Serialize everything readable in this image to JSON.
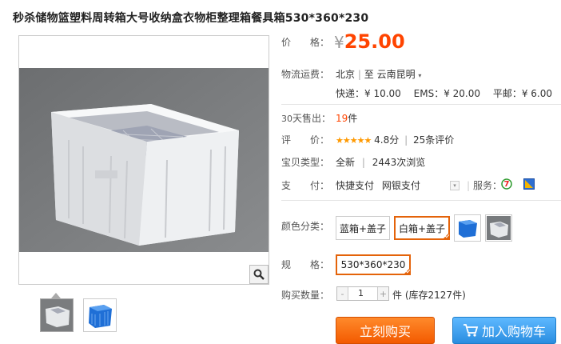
{
  "title": "秒杀储物篮塑料周转箱大号收纳盒衣物柜整理箱餐具箱530*360*230",
  "price": {
    "label": "价　　格：",
    "symbol": "¥",
    "value": "25.00"
  },
  "shipping": {
    "label": "物流运费：",
    "from": "北京",
    "sep": "|",
    "to_label": "至",
    "dest": "云南昆明",
    "express": "快递：¥ 10.00",
    "ems": "EMS：¥ 20.00",
    "surface": "平邮：¥ 6.00"
  },
  "sales": {
    "label_days": "30",
    "label": "天售出：",
    "count": "19",
    "unit": "件"
  },
  "rating": {
    "label": "评　　价：",
    "stars": "★★★★★",
    "score": "4.8分",
    "sep": "|",
    "reviews_count": "25",
    "reviews_suffix": "条评价"
  },
  "type": {
    "label": "宝贝类型：",
    "value": "全新",
    "sep": "|",
    "views_count": "2443",
    "views_suffix": "次浏览"
  },
  "payment": {
    "label": "支　　付：",
    "method1": "快捷支付",
    "method2": "网银支付",
    "service_label": "服务："
  },
  "color": {
    "label": "颜色分类：",
    "options": [
      "蓝箱+盖子",
      "白箱+盖子"
    ],
    "selected": "白箱+盖子"
  },
  "spec": {
    "label": "规　　格：",
    "value": "530*360*230"
  },
  "quantity": {
    "label": "购买数量：",
    "value": "1",
    "minus": "-",
    "plus": "+",
    "unit": "件",
    "stock": "(库存2127件)"
  },
  "buttons": {
    "buy_now": "立刻购买",
    "add_to_cart": "加入购物车"
  },
  "colors": {
    "price": "#ff4400",
    "selected_border": "#e4630a",
    "buy": "#f35a00",
    "cart": "#2a8de0"
  }
}
